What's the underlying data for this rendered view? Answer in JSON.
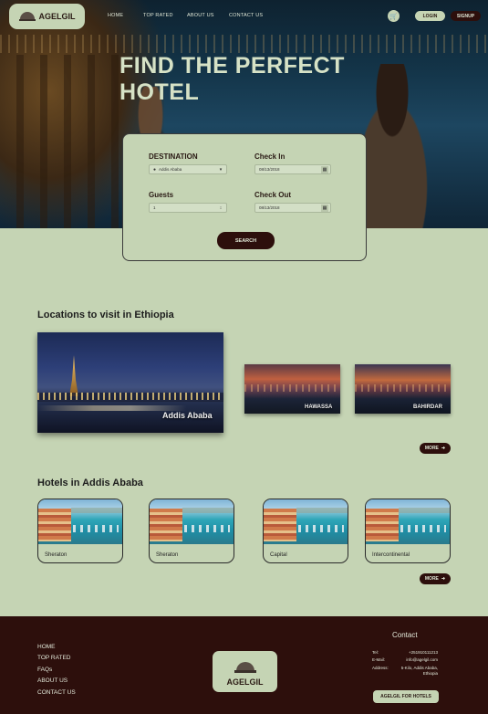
{
  "header": {
    "logo_text": "AGELGIL",
    "nav": [
      "HOME",
      "TOP RATED",
      "ABOUT US",
      "CONTACT US"
    ],
    "login_label": "LOGIN",
    "signup_label": "SIGNUP"
  },
  "hero": {
    "title_line1": "FIND THE PERFECT",
    "title_line2": "HOTEL"
  },
  "search": {
    "destination_label": "DESTINATION",
    "destination_value": "Addis Ababa",
    "checkin_label": "Check In",
    "checkin_value": "08/13/2018",
    "guests_label": "Guests",
    "guests_value": "1",
    "checkout_label": "Check Out",
    "checkout_value": "08/13/2018",
    "search_label": "SEARCH"
  },
  "locations": {
    "title": "Locations to visit in Ethiopia",
    "items": [
      "Addis Ababa",
      "HAWASSA",
      "BAHIRDAR"
    ],
    "more_label": "MORE"
  },
  "hotels": {
    "title": "Hotels in Addis Ababa",
    "items": [
      "Sheraton",
      "Sheraton",
      "Capital",
      "Intercontinental"
    ],
    "more_label": "MORE"
  },
  "footer": {
    "links": [
      "HOME",
      "TOP RATED",
      "FAQs",
      "ABOUT US",
      "CONTACT US"
    ],
    "logo_text": "AGELGIL",
    "contact_title": "Contact",
    "tel_key": "Tel:",
    "tel_value": "+251910111213",
    "email_key": "E-Mail:",
    "email_value": "info@agelgil.com",
    "address_key": "Address:",
    "address_line1": "5-Kilo, Addis Ababa,",
    "address_line2": "Ethiopia",
    "hotels_button": "AGELGIL FOR HOTELS"
  },
  "colors": {
    "background": "#c5d4b4",
    "accent_dark": "#2d0f0c",
    "hero_title": "#d6e2c6"
  },
  "icons": [
    "cloche-logo-icon",
    "cart-icon",
    "location-pin-icon",
    "chevron-down-icon",
    "calendar-icon",
    "stepper-icon",
    "arrow-right-icon"
  ]
}
